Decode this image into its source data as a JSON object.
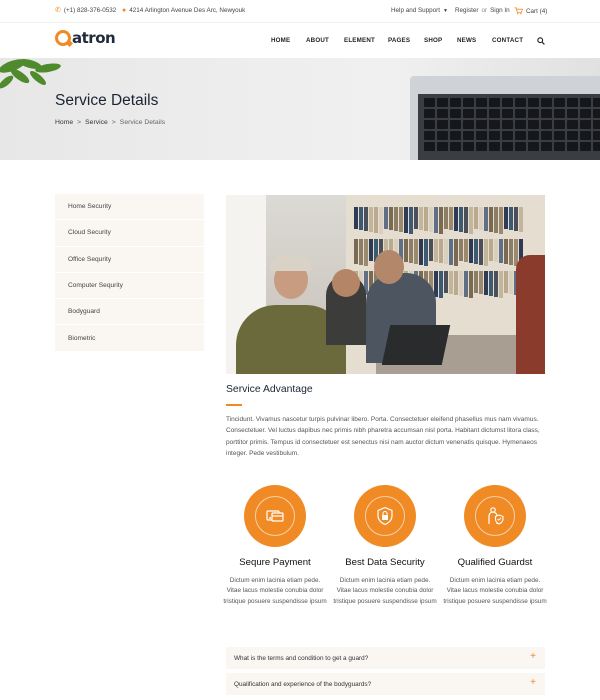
{
  "topbar": {
    "phone": "(+1) 828-376-0532",
    "address": "4214 Arlington Avenue Des Arc, Newyouk",
    "help": "Help and Support",
    "register": "Register",
    "or": "or",
    "signin": "Sign In",
    "cart": "Cart (4)"
  },
  "header": {
    "logo": "atron",
    "nav": [
      "HOME",
      "ABOUT",
      "ELEMENT",
      "PAGES",
      "SHOP",
      "NEWS",
      "CONTACT"
    ]
  },
  "banner": {
    "title": "Service Details",
    "breadcrumb": [
      "Home",
      "Service",
      "Service Details"
    ],
    "separator": ">"
  },
  "sidebar": {
    "items": [
      "Home Security",
      "Cloud Security",
      "Office Sequrity",
      "Computer Sequrity",
      "Bodyguard",
      "Biometric"
    ]
  },
  "main": {
    "heading": "Service Advantage",
    "text": "Tincidunt. Vivamus nascetur turpis pulvinar libero. Porta. Consectetuer eleifend phasellus mus nam vivamus. Consectetuer. Vel luctus dapibus nec primis nibh pharetra accumsan nisl porta. Habitant dictumst litora class, porttitor primis. Tempus id consectetuer est senectus nisi nam auctor dictum venenatis quisque. Hymenaeos integer. Pede vestibulum.",
    "features": [
      {
        "title": "Sequre Payment",
        "text": "Dictum enim lacinia etiam pede. Vitae lacus molestie conubia dolor tristique posuere suspendisse ipsum",
        "icon": "payment-card-icon"
      },
      {
        "title": "Best Data Security",
        "text": "Dictum enim lacinia etiam pede. Vitae lacus molestie conubia dolor tristique posuere suspendisse ipsum",
        "icon": "shield-lock-icon"
      },
      {
        "title": "Qualified Guardst",
        "text": "Dictum enim lacinia etiam pede. Vitae lacus molestie conubia dolor tristique posuere suspendisse ipsum",
        "icon": "guard-shield-icon"
      }
    ],
    "faq": [
      "What is the terms and condition to get a guard?",
      "Qualification and experience of the bodyguards?"
    ],
    "faq_toggle": "+"
  },
  "colors": {
    "accent": "#f08a24",
    "heading": "#1b2434",
    "panel": "#faf6f2"
  }
}
